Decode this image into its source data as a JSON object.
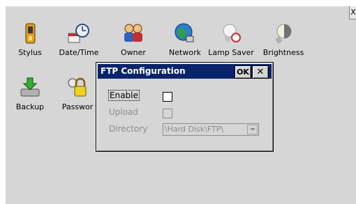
{
  "desktop": {
    "corner_close_label": "X",
    "icons": [
      {
        "label": "Stylus",
        "icon": "stylus-icon"
      },
      {
        "label": "Date/Time",
        "icon": "date-time-icon"
      },
      {
        "label": "Owner",
        "icon": "owner-icon"
      },
      {
        "label": "Network",
        "icon": "network-icon"
      },
      {
        "label": "Lamp Saver",
        "icon": "lamp-saver-icon"
      },
      {
        "label": "Brightness",
        "icon": "brightness-icon"
      },
      {
        "label": "Backup",
        "icon": "backup-icon"
      },
      {
        "label": "Passwor",
        "icon": "password-icon"
      }
    ]
  },
  "dialog": {
    "title": "FTP Configuration",
    "ok_label": "OK",
    "close_label": "✕",
    "enable_label": "Enable",
    "upload_label": "Upload",
    "directory_label": "Directory",
    "directory_value": "\\Hard Disk\\FTP\\",
    "enable_checked": false,
    "upload_checked": false
  },
  "colors": {
    "title_bar": "#08246b",
    "panel": "#d6d6d6",
    "disabled_text": "#8c8c8c"
  }
}
